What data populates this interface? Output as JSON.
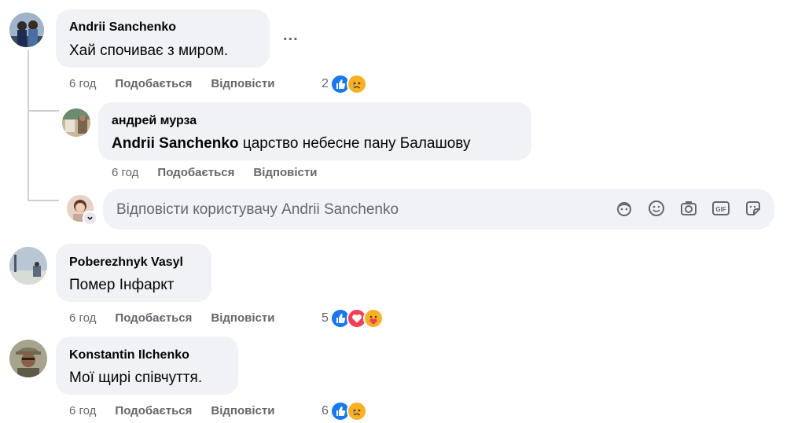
{
  "comments": [
    {
      "author": "Andrii Sanchenko",
      "text": "Хай спочиває з миром.",
      "time": "6 год",
      "like_label": "Подобається",
      "reply_label": "Відповісти",
      "reaction_count": "2",
      "reactions": [
        "like-icon",
        "sad-icon"
      ],
      "replies": [
        {
          "author": "андрей мурза",
          "mention": "Andrii Sanchenko",
          "text": "царство небесне пану Балашову",
          "time": "6 год",
          "like_label": "Подобається",
          "reply_label": "Відповісти"
        }
      ]
    },
    {
      "author": "Poberezhnyk Vasyl",
      "text": "Помер Інфаркт",
      "time": "6 год",
      "like_label": "Подобається",
      "reply_label": "Відповісти",
      "reaction_count": "5",
      "reactions": [
        "like-icon",
        "love-icon",
        "care-icon"
      ]
    },
    {
      "author": "Konstantin Ilchenko",
      "text": "Мої щирі співчуття.",
      "time": "6 год",
      "like_label": "Подобається",
      "reply_label": "Відповісти",
      "reaction_count": "6",
      "reactions": [
        "like-icon",
        "sad-icon"
      ]
    }
  ],
  "more_options_label": "...",
  "reply_box": {
    "placeholder": "Відповісти користувачу Andrii Sanchenko",
    "tools": [
      "avatar-sticker-icon",
      "emoji-icon",
      "camera-icon",
      "gif-icon",
      "sticker-icon"
    ]
  },
  "colors": {
    "bubble": "#f0f2f5",
    "meta_text": "#65676b",
    "like_blue": "#1877f2",
    "love_red": "#f33e58",
    "sad_yellow": "#f7b125"
  }
}
